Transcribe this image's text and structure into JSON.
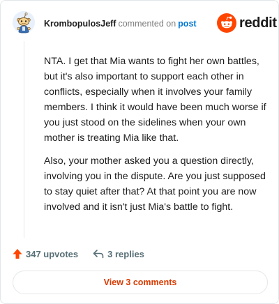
{
  "header": {
    "username": "KrombopulosJeff",
    "action_text": "commented on",
    "post_link": "post",
    "logo_text": "reddit"
  },
  "comment": {
    "paragraphs": [
      "NTA. I get that Mia wants to fight her own battles, but it's also important to support each other in conflicts, especially when it involves your family members. I think it would have been much worse if you just stood on the sidelines when your own mother is treating Mia like that.",
      "Also, your mother asked you a question directly, involving you in the dispute. Are you just supposed to stay quiet after that? At that point you are now involved and it isn't just Mia's battle to fight."
    ]
  },
  "actions": {
    "upvotes": "347 upvotes",
    "replies": "3 replies"
  },
  "view_comments_label": "View 3 comments",
  "colors": {
    "accent": "#ff4500",
    "link": "#0079d3",
    "button_text": "#d93a00",
    "muted": "#576f76"
  },
  "icons": {
    "avatar": "snoo-avatar",
    "logo": "reddit-snoo-icon",
    "upvote": "upvote-arrow-icon",
    "reply": "reply-arrow-icon"
  }
}
